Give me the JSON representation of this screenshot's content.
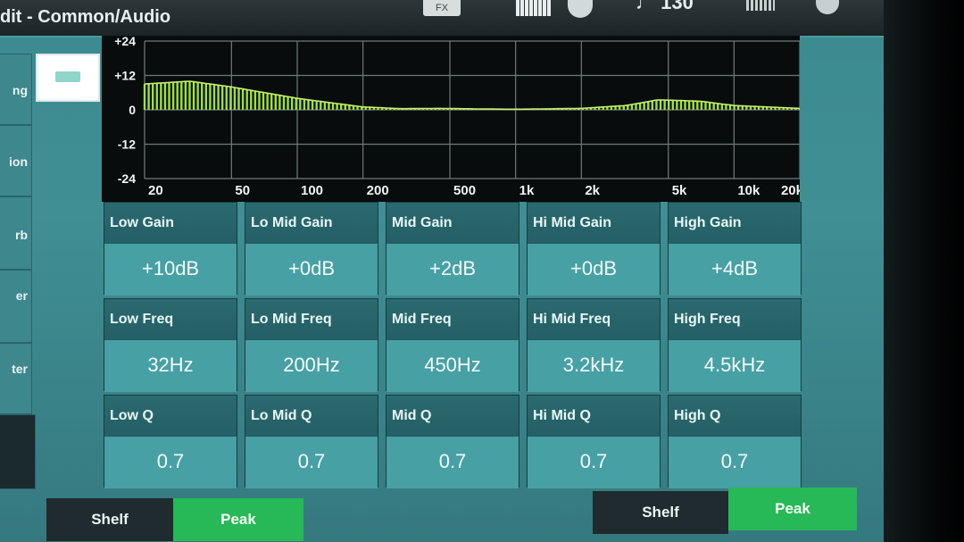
{
  "window": {
    "title": "dit - Common/Audio"
  },
  "toolbar": {
    "fx_label": "FX",
    "tempo": "♩ 130"
  },
  "sidebar": {
    "items": [
      {
        "label": "ng"
      },
      {
        "label": "ion"
      },
      {
        "label": "rb"
      },
      {
        "label": "er"
      },
      {
        "label": "ter"
      }
    ]
  },
  "graph": {
    "y_ticks": [
      "+24",
      "+12",
      "0",
      "-12",
      "-24"
    ],
    "x_ticks": [
      "20",
      "50",
      "100",
      "200",
      "500",
      "1k",
      "2k",
      "5k",
      "10k",
      "20k"
    ],
    "curve_color": "#9ee23a"
  },
  "chart_data": {
    "type": "area",
    "x": [
      20,
      32,
      50,
      100,
      200,
      300,
      450,
      700,
      1000,
      2000,
      3200,
      4500,
      7000,
      10000,
      20000
    ],
    "values": [
      9,
      10,
      8,
      4,
      1,
      0.4,
      0.5,
      0.3,
      0.2,
      0.5,
      1.5,
      3.5,
      3,
      1.5,
      0.5
    ],
    "ylim": [
      -24,
      24
    ],
    "xlim": [
      20,
      20000
    ],
    "x_scale": "log",
    "grid": true,
    "ylabel": "",
    "xlabel": "",
    "title": ""
  },
  "eq": {
    "columns": [
      {
        "gain_label": "Low Gain",
        "gain": "+10dB",
        "freq_label": "Low Freq",
        "freq": "32Hz",
        "q_label": "Low Q",
        "q": "0.7"
      },
      {
        "gain_label": "Lo Mid Gain",
        "gain": "+0dB",
        "freq_label": "Lo Mid Freq",
        "freq": "200Hz",
        "q_label": "Lo Mid Q",
        "q": "0.7"
      },
      {
        "gain_label": "Mid Gain",
        "gain": "+2dB",
        "freq_label": "Mid Freq",
        "freq": "450Hz",
        "q_label": "Mid Q",
        "q": "0.7"
      },
      {
        "gain_label": "Hi Mid Gain",
        "gain": "+0dB",
        "freq_label": "Hi Mid Freq",
        "freq": "3.2kHz",
        "q_label": "Hi Mid Q",
        "q": "0.7"
      },
      {
        "gain_label": "High Gain",
        "gain": "+4dB",
        "freq_label": "High Freq",
        "freq": "4.5kHz",
        "q_label": "High Q",
        "q": "0.7"
      }
    ]
  },
  "low_shape": {
    "shelf": "Shelf",
    "peak": "Peak",
    "selected": "Peak"
  },
  "high_shape": {
    "shelf": "Shelf",
    "peak": "Peak",
    "selected": "Peak"
  },
  "colors": {
    "accent_green": "#27b957",
    "panel": "#44999d",
    "label_bar": "#245f65"
  }
}
